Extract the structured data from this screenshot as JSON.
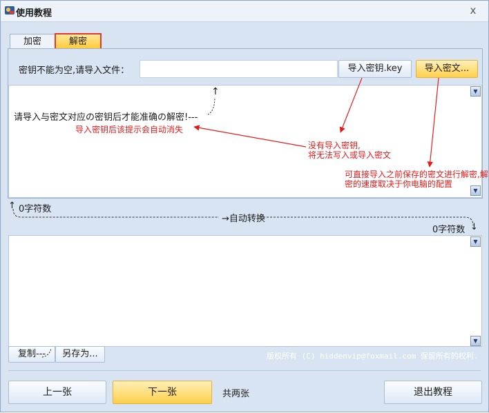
{
  "window": {
    "title": "使用教程",
    "close_glyph": "x"
  },
  "tabs": [
    {
      "label": "加密",
      "active": false
    },
    {
      "label": "解密",
      "active": true
    }
  ],
  "key_row": {
    "label": "密钥不能为空,请导入文件：",
    "input_value": "",
    "import_key_label": "导入密钥.key",
    "import_cipher_label": "导入密文..."
  },
  "top_area": {
    "hint": "请导入与密文对应の密钥后才能准确の解密!---",
    "arrow_glyph": "↑"
  },
  "annotations": {
    "hint_disappears": "导入密钥后该提示会自动消失",
    "no_key_line1": "没有导入密钥,",
    "no_key_line2": "将无法写入或导入密文",
    "direct_import_line1": "可直接导入之前保存的密文进行解密,解",
    "direct_import_line2": "密的速度取决于你电脑的配置"
  },
  "counts": {
    "top": "0字符数",
    "bottom": "0字符数",
    "up_arrow": "↑",
    "down_arrow": "↓",
    "auto_convert": "→自动转换"
  },
  "bottom_actions": {
    "copy_label": "复制---",
    "saveas_label": "另存为...",
    "copyright": "版权所有 (C) hiddenvip@foxmail.com 保留所有的权利."
  },
  "footer": {
    "prev_label": "上一张",
    "next_label": "下一张",
    "pages_text": "共两张",
    "exit_label": "退出教程"
  },
  "colors": {
    "annotation_red": "#e21b1b",
    "highlight_yellow": "#ffcf4a",
    "window_bg": "#d8e4f2"
  }
}
